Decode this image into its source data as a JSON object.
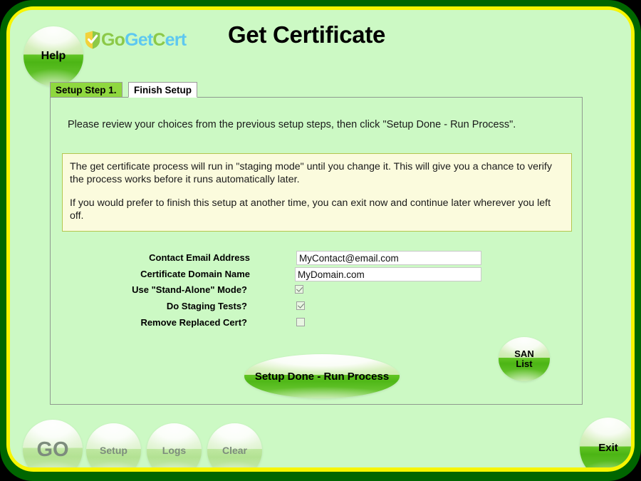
{
  "window": {
    "frame_outer_color": "#006600",
    "frame_accent_color": "#f7f500",
    "background_color": "#ccf9c4"
  },
  "header": {
    "title": "Get Certificate",
    "help_label": "Help",
    "brand": {
      "shield_icon": "shield-check-icon",
      "shield_left_color": "#f2d23c",
      "shield_right_color": "#8cc948",
      "part_go": "Go",
      "part_get": "Get",
      "part_c": "C",
      "part_ert": "ert"
    }
  },
  "tabs": [
    {
      "label": "Setup Step 1.",
      "active": false
    },
    {
      "label": "Finish Setup",
      "active": true
    }
  ],
  "panel": {
    "instruction": "Please review your choices from the previous setup steps, then click \"Setup Done - Run Process\".",
    "notice": {
      "paragraph1": "The get certificate process will run in \"staging mode\" until you change it. This will give you a chance to verify the process works before it runs automatically later.",
      "paragraph2": "If you would prefer to finish this setup at another time, you can exit now and continue later wherever you left off.",
      "background_color": "#fbfbdd",
      "border_color": "#b4c64e"
    },
    "form": {
      "contact_email": {
        "label": "Contact Email Address",
        "value": "MyContact@email.com",
        "placeholder": ""
      },
      "certificate_domain": {
        "label": "Certificate Domain Name",
        "value": "MyDomain.com",
        "placeholder": ""
      },
      "stand_alone_mode": {
        "label": "Use \"Stand-Alone\" Mode?",
        "checked": true
      },
      "staging_tests": {
        "label": "Do Staging Tests?",
        "checked": true
      },
      "remove_replaced_cert": {
        "label": "Remove Replaced Cert?",
        "checked": false
      }
    },
    "san_list_button": {
      "line1": "SAN",
      "line2": "List"
    },
    "run_process_label": "Setup Done - Run Process"
  },
  "footer": {
    "buttons": [
      {
        "label": "GO",
        "enabled": false
      },
      {
        "label": "Setup",
        "enabled": false
      },
      {
        "label": "Logs",
        "enabled": false
      },
      {
        "label": "Clear",
        "enabled": false
      }
    ],
    "exit_label": "Exit"
  }
}
